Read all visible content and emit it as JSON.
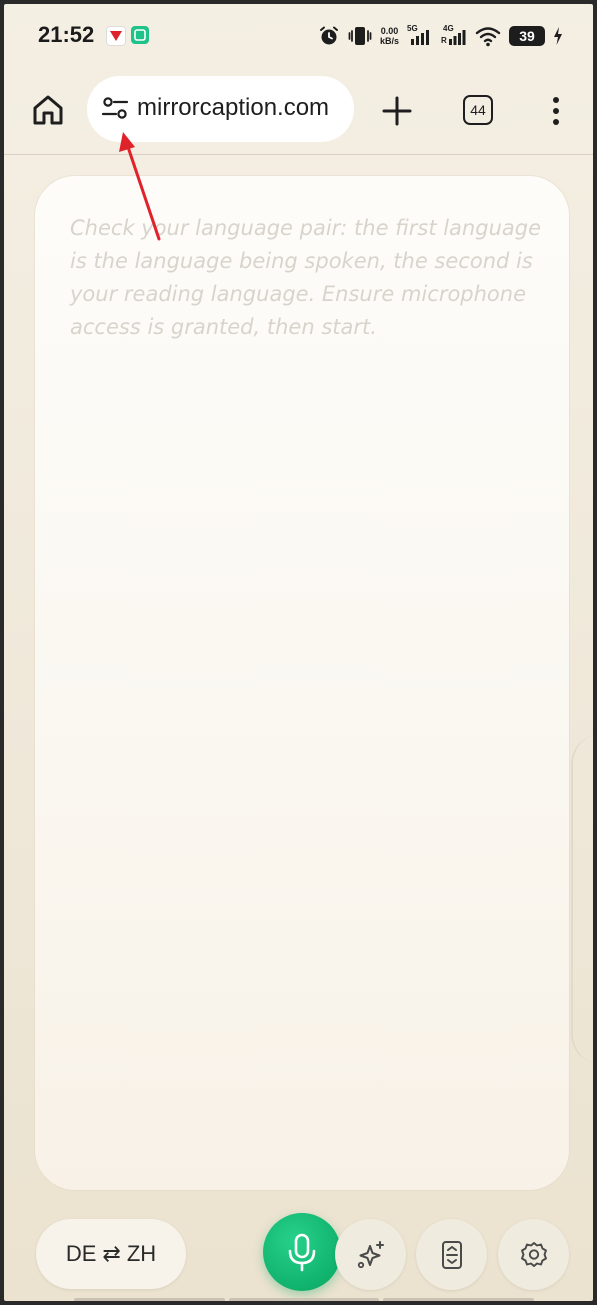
{
  "status_bar": {
    "time": "21:52",
    "net_speed_value": "0.00",
    "net_speed_unit": "kB/s",
    "signal_1": "5G",
    "signal_2": "4G",
    "signal_2_sub": "R",
    "battery": "39",
    "icons": [
      "app-notification-red-icon",
      "app-notification-green-icon",
      "alarm-icon",
      "vibrate-icon",
      "signal-icon",
      "wifi-icon",
      "charging-icon"
    ]
  },
  "toolbar": {
    "url": "mirrorcaption.com",
    "tab_count": "44",
    "icons": [
      "home-icon",
      "site-settings-icon",
      "new-tab-icon",
      "tab-switcher-icon",
      "more-menu-icon"
    ]
  },
  "caption": {
    "placeholder": "Check your language pair: the first language is the language being spoken, the second is your reading language. Ensure microphone access is granted, then start."
  },
  "controls": {
    "source_lang": "DE",
    "swap_symbol": "⇄",
    "target_lang": "ZH",
    "icons": [
      "microphone-icon",
      "ai-sparkle-icon",
      "auto-scroll-icon",
      "settings-icon"
    ]
  },
  "colors": {
    "background": "#f1ebdd",
    "card": "#fbf9f4",
    "accent_green": "#12b36d",
    "annotation_red": "#e0222b",
    "placeholder_text": "#d8d4cc"
  }
}
